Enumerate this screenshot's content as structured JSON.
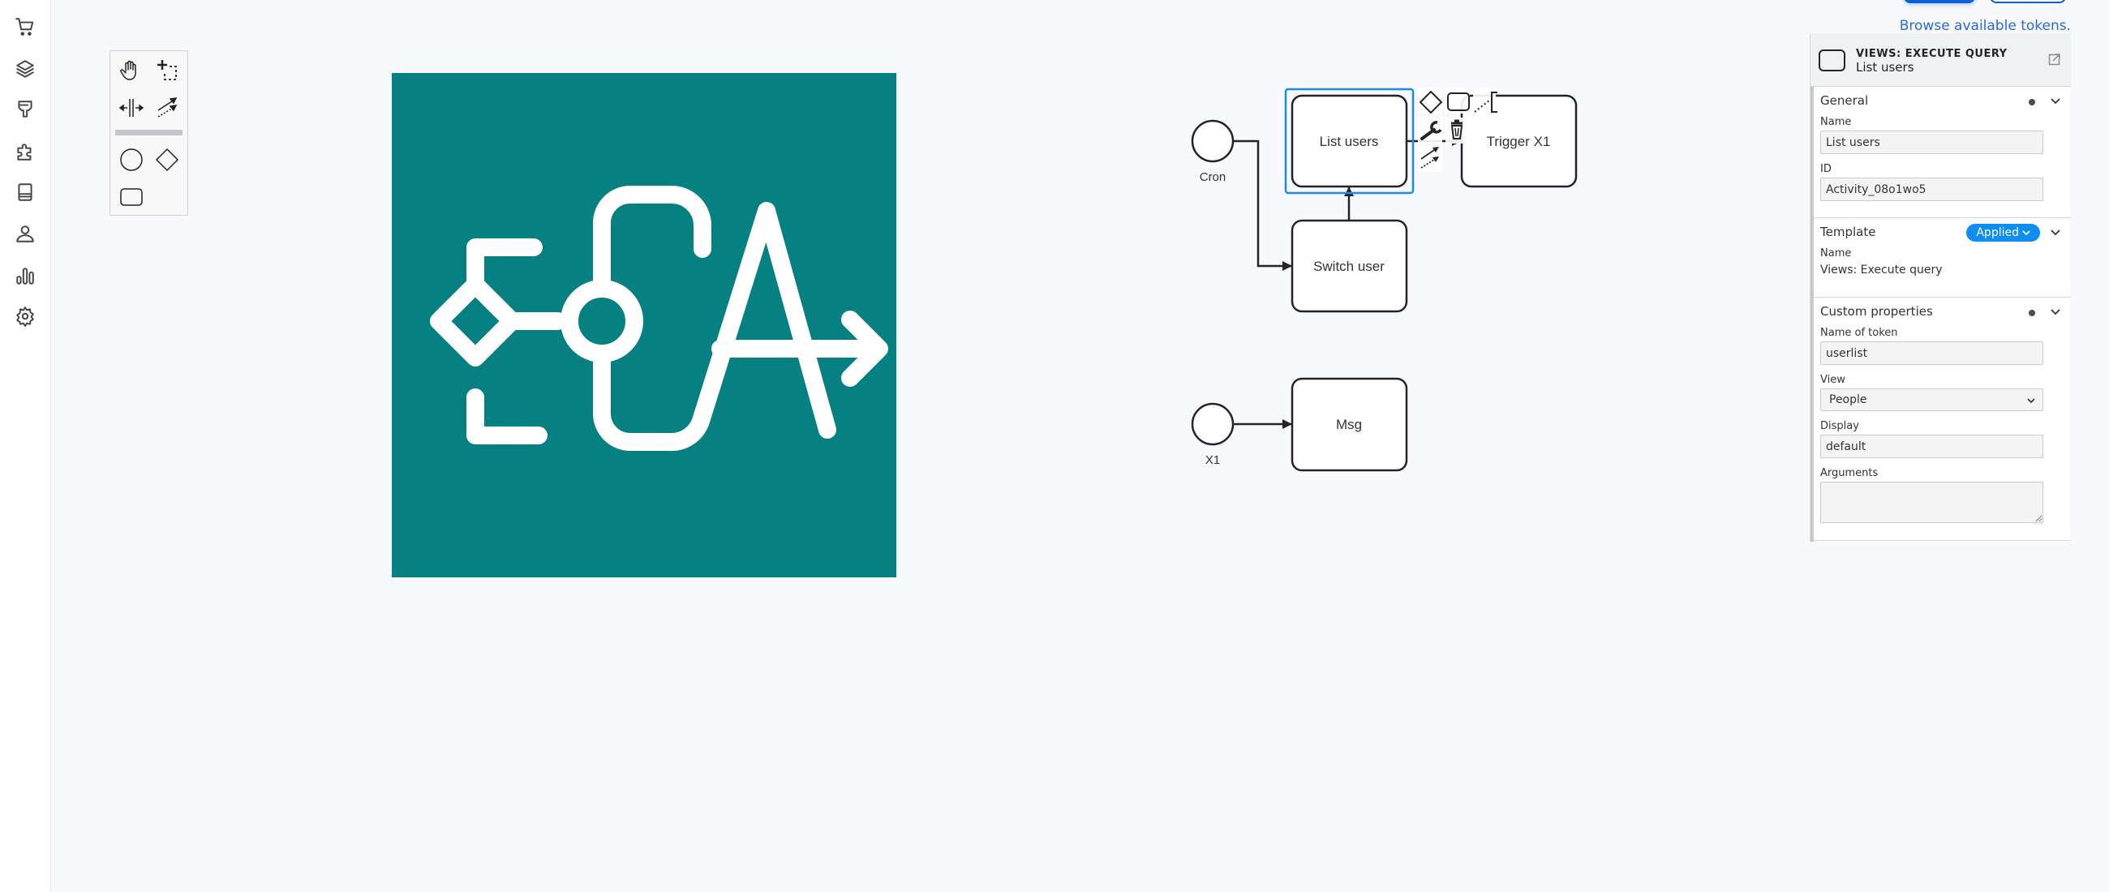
{
  "sidebar": {
    "items": [
      {
        "icon": "cart-icon",
        "label": "Commerce"
      },
      {
        "icon": "layers-icon",
        "label": "Structure"
      },
      {
        "icon": "paintbrush-icon",
        "label": "Appearance"
      },
      {
        "icon": "puzzle-icon",
        "label": "Extend"
      },
      {
        "icon": "book-icon",
        "label": "Content"
      },
      {
        "icon": "user-icon",
        "label": "People"
      },
      {
        "icon": "bar-chart-icon",
        "label": "Reports"
      },
      {
        "icon": "gear-icon",
        "label": "Configuration"
      }
    ]
  },
  "palette": {
    "tools": [
      {
        "icon": "hand-tool-icon",
        "label": "Activate hand tool"
      },
      {
        "icon": "lasso-tool-icon",
        "label": "Activate lasso tool"
      },
      {
        "icon": "space-tool-icon",
        "label": "Activate create/remove space tool"
      },
      {
        "icon": "global-connect-tool-icon",
        "label": "Activate global connect tool"
      },
      {
        "icon": "start-event-icon",
        "label": "Create start event"
      },
      {
        "icon": "gateway-icon",
        "label": "Create gateway"
      },
      {
        "icon": "task-icon",
        "label": "Create task"
      }
    ]
  },
  "logo": {
    "text": "ECA",
    "color": "#068080"
  },
  "top": {
    "browse_link": "Browse available tokens."
  },
  "diagram": {
    "events": [
      {
        "id": "cron",
        "label": "Cron"
      },
      {
        "id": "x1",
        "label": "X1"
      }
    ],
    "tasks": [
      {
        "id": "list-users",
        "label": "List users",
        "selected": true
      },
      {
        "id": "switch-user",
        "label": "Switch user",
        "selected": false
      },
      {
        "id": "trigger-x1",
        "label": "Trigger X1",
        "selected": false
      },
      {
        "id": "msg",
        "label": "Msg",
        "selected": false
      }
    ],
    "flows": [
      {
        "from": "cron",
        "to": "switch-user"
      },
      {
        "from": "switch-user",
        "to": "list-users"
      },
      {
        "from": "list-users",
        "to": "trigger-x1"
      },
      {
        "from": "x1",
        "to": "msg"
      }
    ],
    "context_pad": [
      "append-gateway-icon",
      "append-task-icon",
      "text-annotation-icon",
      "change-type-wrench-icon",
      "delete-trash-icon",
      "connect-icon"
    ],
    "selection_color": "#1a8ce8"
  },
  "properties": {
    "header": {
      "type": "VIEWS: EXECUTE QUERY",
      "name": "List users"
    },
    "groups": {
      "general": {
        "title": "General",
        "name_label": "Name",
        "name_value": "List users",
        "id_label": "ID",
        "id_value": "Activity_08o1wo5"
      },
      "template": {
        "title": "Template",
        "badge": "Applied",
        "name_label": "Name",
        "name_value": "Views: Execute query"
      },
      "custom": {
        "title": "Custom properties",
        "token_label": "Name of token",
        "token_value": "userlist",
        "view_label": "View",
        "view_value": "People",
        "display_label": "Display",
        "display_value": "default",
        "arguments_label": "Arguments",
        "arguments_value": ""
      }
    }
  }
}
